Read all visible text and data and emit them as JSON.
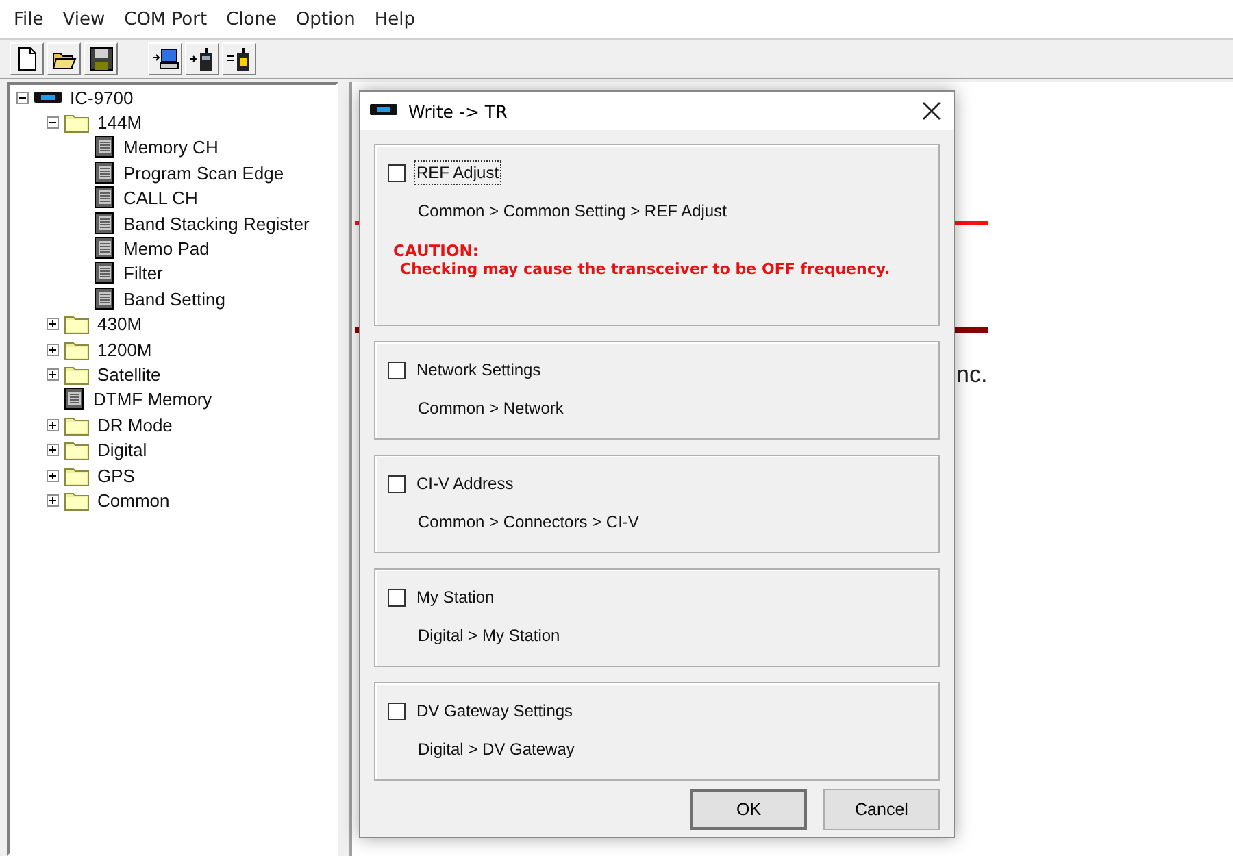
{
  "menu": [
    "File",
    "View",
    "COM Port",
    "Clone",
    "Option",
    "Help"
  ],
  "toolbar": [
    {
      "kind": "new"
    },
    {
      "kind": "open"
    },
    {
      "kind": "save"
    },
    {
      "kind": "read"
    },
    {
      "kind": "write"
    },
    {
      "kind": "info"
    }
  ],
  "tree": [
    {
      "label": "IC-9700",
      "kind": "radio",
      "expanded": true,
      "children": [
        {
          "label": "144M",
          "kind": "folder",
          "expanded": true,
          "children": [
            {
              "label": "Memory CH",
              "kind": "page"
            },
            {
              "label": "Program Scan Edge",
              "kind": "page"
            },
            {
              "label": "CALL CH",
              "kind": "page"
            },
            {
              "label": "Band Stacking Register",
              "kind": "page"
            },
            {
              "label": "Memo Pad",
              "kind": "page"
            },
            {
              "label": "Filter",
              "kind": "page"
            },
            {
              "label": "Band Setting",
              "kind": "page"
            }
          ]
        },
        {
          "label": "430M",
          "kind": "folder",
          "expanded": false
        },
        {
          "label": "1200M",
          "kind": "folder",
          "expanded": false
        },
        {
          "label": "Satellite",
          "kind": "folder",
          "expanded": false
        },
        {
          "label": "DTMF Memory",
          "kind": "page"
        },
        {
          "label": "DR Mode",
          "kind": "folder",
          "expanded": false
        },
        {
          "label": "Digital",
          "kind": "folder",
          "expanded": false
        },
        {
          "label": "GPS",
          "kind": "folder",
          "expanded": false
        },
        {
          "label": "Common",
          "kind": "folder",
          "expanded": false
        }
      ]
    }
  ],
  "background_text": "nc.",
  "dialog": {
    "title": "Write -> TR",
    "items": [
      {
        "label": "REF Adjust",
        "checked": false,
        "focused": true,
        "path": "Common > Common Setting > REF Adjust",
        "caution": {
          "title": "CAUTION:",
          "text": "Checking may cause the transceiver to be OFF frequency."
        }
      },
      {
        "label": "Network Settings",
        "checked": false,
        "focused": false,
        "path": "Common > Network"
      },
      {
        "label": "CI-V Address",
        "checked": false,
        "focused": false,
        "path": "Common > Connectors > CI-V"
      },
      {
        "label": "My Station",
        "checked": false,
        "focused": false,
        "path": "Digital > My Station"
      },
      {
        "label": "DV Gateway Settings",
        "checked": false,
        "focused": false,
        "path": "Digital > DV Gateway"
      }
    ],
    "buttons": [
      "OK",
      "Cancel"
    ]
  }
}
